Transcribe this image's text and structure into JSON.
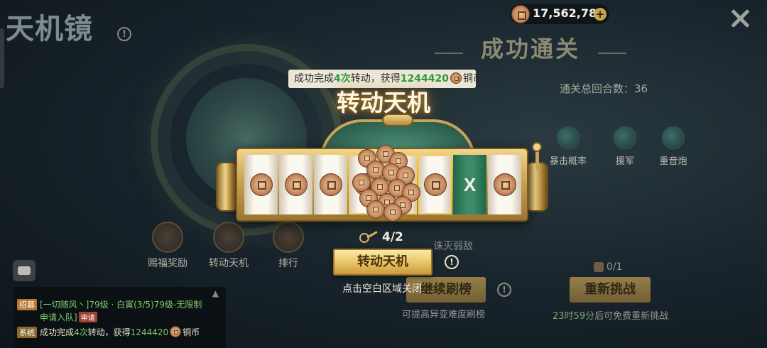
{
  "background": {
    "title": "天机镜",
    "success_banner": "成功通关",
    "rounds_label": "通关总回合数：36",
    "buffs": [
      "暴击概率",
      "援军",
      "重音炮"
    ],
    "menu": [
      {
        "label": "赐福奖励",
        "icon": "gift-icon"
      },
      {
        "label": "转动天机",
        "icon": "wheel-icon"
      },
      {
        "label": "排行",
        "icon": "ranking-icon"
      }
    ],
    "weak_label": "诛灭弱敌",
    "continue_button": "继续刷榜",
    "continue_hint": "可提高异变难度刷榜",
    "retry_button": "重新挑战",
    "retry_hint_time": "23时59分",
    "retry_hint_rest": "后可免费重新挑战",
    "tickets": "0/1"
  },
  "currency": {
    "value": "17,562,782",
    "icon": "copper-coin-icon",
    "plus_icon": "plus-icon"
  },
  "chat": {
    "recruit_tag": "招募",
    "recruit_text": "[一切随风丶]79级 · 白寅(3/5)79级-无限制",
    "recruit_line2": "申请入队]",
    "apply_tag": "申请",
    "system_tag": "系统",
    "system_text_a": "成功完成",
    "system_count": "4次",
    "system_text_b": "转动，获得",
    "system_amount": "1244420",
    "system_unit": "铜币"
  },
  "modal": {
    "toast": {
      "prefix": "成功完成",
      "count": "4次",
      "mid": "转动，获得",
      "amount": "1244420",
      "unit": "铜币"
    },
    "title": "转动天机",
    "slots": [
      "coin",
      "coin",
      "coin",
      "coin",
      "coin",
      "coin",
      "x",
      "coin"
    ],
    "x_symbol": "X",
    "keys": "4/2",
    "spin_button": "转动天机",
    "close_hint": "点击空白区域关闭"
  },
  "colors": {
    "accent_gold": "#e9c66a",
    "highlight_green": "#2e9a3e",
    "slot_green": "#3d8a68"
  }
}
